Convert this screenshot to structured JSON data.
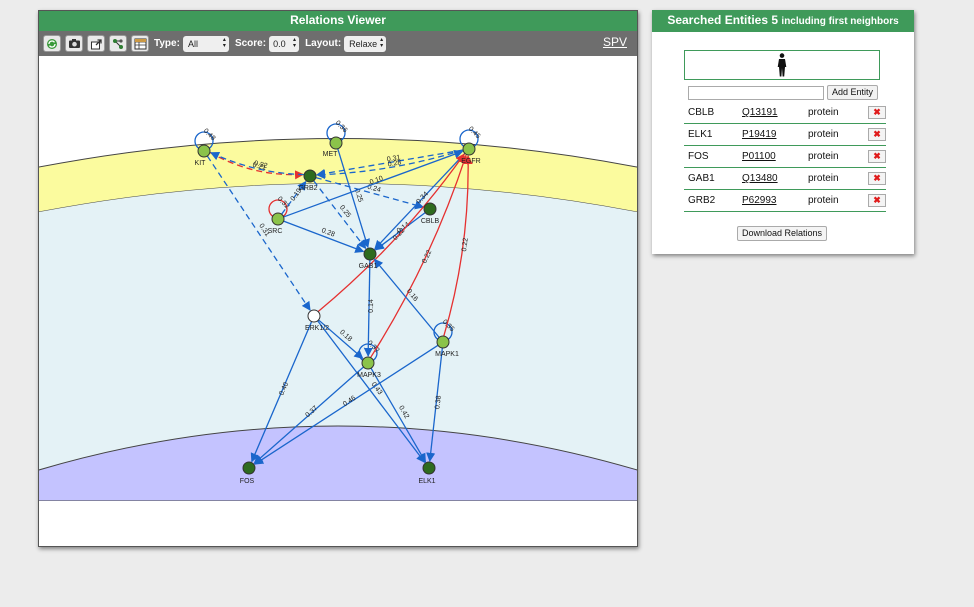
{
  "viewer": {
    "title": "Relations Viewer",
    "toolbar": {
      "type_label": "Type:",
      "type_value": "All",
      "score_label": "Score:",
      "score_value": "0.0",
      "layout_label": "Layout:",
      "layout_value": "Relaxe",
      "spv_link": "SPV"
    },
    "tools": [
      "refresh-icon",
      "camera-icon",
      "export-icon",
      "network-icon",
      "table-icon"
    ]
  },
  "graph": {
    "nodes": [
      {
        "id": "KIT",
        "label": "KIT",
        "color": "#8bc34a"
      },
      {
        "id": "MET",
        "label": "MET",
        "color": "#8bc34a"
      },
      {
        "id": "EGFR",
        "label": "EGFR",
        "color": "#8bc34a"
      },
      {
        "id": "GRB2",
        "label": "GRB2",
        "color": "#2e6b1f"
      },
      {
        "id": "SRC",
        "label": "SRC",
        "color": "#8bc34a"
      },
      {
        "id": "CBLB",
        "label": "CBLB",
        "color": "#2e6b1f"
      },
      {
        "id": "GAB1",
        "label": "GAB1",
        "color": "#2e6b1f"
      },
      {
        "id": "ERK1/2",
        "label": "ERK1/2",
        "color": "#ffffff"
      },
      {
        "id": "MAPK3",
        "label": "MAPK3",
        "color": "#8bc34a"
      },
      {
        "id": "MAPK1",
        "label": "MAPK1",
        "color": "#8bc34a"
      },
      {
        "id": "FOS",
        "label": "FOS",
        "color": "#2e6b1f"
      },
      {
        "id": "ELK1",
        "label": "ELK1",
        "color": "#2e6b1f"
      }
    ],
    "edges": [
      {
        "from": "KIT",
        "to": "KIT",
        "score": "0.48",
        "kind": "blue-solid"
      },
      {
        "from": "MET",
        "to": "MET",
        "score": "0.36",
        "kind": "blue-solid"
      },
      {
        "from": "EGFR",
        "to": "EGFR",
        "score": "0.45",
        "kind": "blue-solid"
      },
      {
        "from": "SRC",
        "to": "SRC",
        "score": "0.32",
        "kind": "red-solid"
      },
      {
        "from": "MAPK3",
        "to": "MAPK3",
        "score": "0.32",
        "kind": "blue-solid"
      },
      {
        "from": "MAPK1",
        "to": "MAPK1",
        "score": "0.35",
        "kind": "blue-solid"
      },
      {
        "from": "KIT",
        "to": "GRB2",
        "score": "0.21",
        "kind": "red-dashed"
      },
      {
        "from": "GRB2",
        "to": "KIT",
        "score": "0.32",
        "kind": "blue-dashed"
      },
      {
        "from": "EGFR",
        "to": "GRB2",
        "score": "0.31",
        "kind": "blue-dashed"
      },
      {
        "from": "EGFR",
        "to": "GRB2",
        "score": "0.28",
        "kind": "blue-dashed"
      },
      {
        "from": "KIT",
        "to": "ERK1/2",
        "score": "0.31",
        "kind": "blue-dashed"
      },
      {
        "from": "SRC",
        "to": "GRB2",
        "score": "0.19",
        "kind": "blue-dashed"
      },
      {
        "from": "GRB2",
        "to": "GAB1",
        "score": "0.25",
        "kind": "blue-dashed"
      },
      {
        "from": "GRB2",
        "to": "CBLB",
        "score": "0.24",
        "kind": "blue-dashed"
      },
      {
        "from": "MET",
        "to": "GAB1",
        "score": "0.25",
        "kind": "blue-solid"
      },
      {
        "from": "SRC",
        "to": "GAB1",
        "score": "0.28",
        "kind": "blue-solid"
      },
      {
        "from": "SRC",
        "to": "EGFR",
        "score": "0.10",
        "kind": "blue-solid"
      },
      {
        "from": "EGFR",
        "to": "GAB1",
        "score": "0.34",
        "kind": "blue-solid"
      },
      {
        "from": "CBLB",
        "to": "GAB1",
        "score": "0.14",
        "kind": "blue-solid"
      },
      {
        "from": "ERK1/2",
        "to": "EGFR",
        "score": "0.22",
        "kind": "red-solid"
      },
      {
        "from": "MAPK3",
        "to": "EGFR",
        "score": "0.22",
        "kind": "red-solid"
      },
      {
        "from": "MAPK1",
        "to": "EGFR",
        "score": "0.22",
        "kind": "red-solid"
      },
      {
        "from": "GAB1",
        "to": "MAPK3",
        "score": "0.14",
        "kind": "blue-solid"
      },
      {
        "from": "MAPK1",
        "to": "GAB1",
        "score": "0.16",
        "kind": "blue-solid"
      },
      {
        "from": "ERK1/2",
        "to": "MAPK3",
        "score": "0.18",
        "kind": "blue-solid"
      },
      {
        "from": "ERK1/2",
        "to": "FOS",
        "score": "0.40",
        "kind": "blue-solid"
      },
      {
        "from": "ERK1/2",
        "to": "ELK1",
        "score": "0.43",
        "kind": "blue-solid"
      },
      {
        "from": "MAPK3",
        "to": "FOS",
        "score": "0.37",
        "kind": "blue-solid"
      },
      {
        "from": "MAPK3",
        "to": "ELK1",
        "score": "0.42",
        "kind": "blue-solid"
      },
      {
        "from": "MAPK1",
        "to": "FOS",
        "score": "0.46",
        "kind": "blue-solid"
      },
      {
        "from": "MAPK1",
        "to": "ELK1",
        "score": "0.38",
        "kind": "blue-solid"
      }
    ],
    "colors": {
      "membrane": "#fbfb9e",
      "cytoplasm": "#e4f2f6",
      "nucleus": "#c4c3ff",
      "blue": "#1a66cc",
      "red": "#e53030"
    }
  },
  "entities": {
    "title": "Searched Entities",
    "count": "5",
    "subtitle": "including first neighbors",
    "add_button": "Add Entity",
    "input_value": "",
    "rows": [
      {
        "name": "CBLB",
        "uniprot": "Q13191",
        "type": "protein"
      },
      {
        "name": "ELK1",
        "uniprot": "P19419",
        "type": "protein"
      },
      {
        "name": "FOS",
        "uniprot": "P01100",
        "type": "protein"
      },
      {
        "name": "GAB1",
        "uniprot": "Q13480",
        "type": "protein"
      },
      {
        "name": "GRB2",
        "uniprot": "P62993",
        "type": "protein"
      }
    ],
    "delete_glyph": "✖",
    "download_button": "Download Relations"
  }
}
